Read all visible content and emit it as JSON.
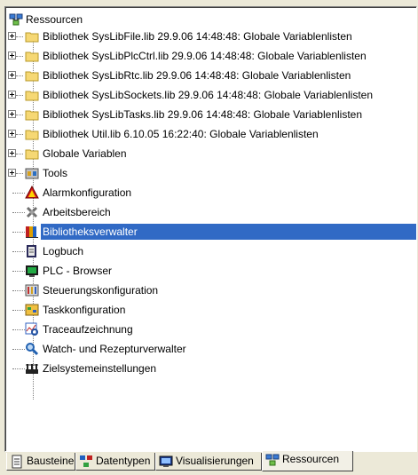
{
  "tree": {
    "root_label": "Ressourcen",
    "items": [
      {
        "label": "Bibliothek SysLibFile.lib 29.9.06 14:48:48: Globale Variablenlisten",
        "icon": "folder-icon",
        "expandable": true
      },
      {
        "label": "Bibliothek SysLibPlcCtrl.lib 29.9.06 14:48:48: Globale Variablenlisten",
        "icon": "folder-icon",
        "expandable": true
      },
      {
        "label": "Bibliothek SysLibRtc.lib 29.9.06 14:48:48: Globale Variablenlisten",
        "icon": "folder-icon",
        "expandable": true
      },
      {
        "label": "Bibliothek SysLibSockets.lib 29.9.06 14:48:48: Globale Variablenlisten",
        "icon": "folder-icon",
        "expandable": true
      },
      {
        "label": "Bibliothek SysLibTasks.lib 29.9.06 14:48:48: Globale Variablenlisten",
        "icon": "folder-icon",
        "expandable": true
      },
      {
        "label": "Bibliothek Util.lib 6.10.05 16:22:40: Globale Variablenlisten",
        "icon": "folder-icon",
        "expandable": true
      },
      {
        "label": "Globale Variablen",
        "icon": "folder-icon",
        "expandable": true
      },
      {
        "label": "Tools",
        "icon": "tools-icon",
        "expandable": true
      },
      {
        "label": "Alarmkonfiguration",
        "icon": "alarm-icon",
        "expandable": false
      },
      {
        "label": "Arbeitsbereich",
        "icon": "workspace-icon",
        "expandable": false
      },
      {
        "label": "Bibliotheksverwalter",
        "icon": "library-manager-icon",
        "expandable": false,
        "selected": true
      },
      {
        "label": "Logbuch",
        "icon": "logbook-icon",
        "expandable": false
      },
      {
        "label": "PLC - Browser",
        "icon": "plc-browser-icon",
        "expandable": false
      },
      {
        "label": "Steuerungskonfiguration",
        "icon": "controller-config-icon",
        "expandable": false
      },
      {
        "label": "Taskkonfiguration",
        "icon": "task-config-icon",
        "expandable": false
      },
      {
        "label": "Traceaufzeichnung",
        "icon": "trace-icon",
        "expandable": false
      },
      {
        "label": "Watch- und Rezepturverwalter",
        "icon": "watch-magnifier-icon",
        "expandable": false
      },
      {
        "label": "Zielsystemeinstellungen",
        "icon": "target-settings-icon",
        "expandable": false
      }
    ]
  },
  "tabs": [
    {
      "label": "Bausteine",
      "icon": "pou-icon"
    },
    {
      "label": "Datentypen",
      "icon": "datatypes-icon"
    },
    {
      "label": "Visualisierungen",
      "icon": "visualization-icon"
    },
    {
      "label": "Ressourcen",
      "icon": "resources-icon",
      "active": true
    }
  ],
  "colors": {
    "selection": "#316ac5",
    "folder": "#f6d874",
    "panel_bg": "#ffffff",
    "window_bg": "#ece9d8"
  }
}
